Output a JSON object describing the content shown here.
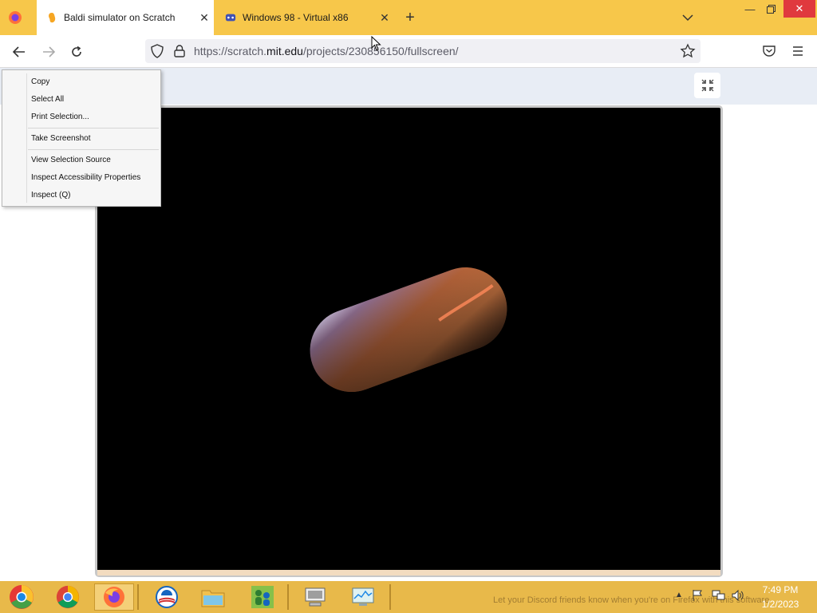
{
  "browser": {
    "tabs": [
      {
        "label": "Baldi simulator on Scratch",
        "active": true
      },
      {
        "label": "Windows 98 - Virtual x86",
        "active": false
      }
    ],
    "url": {
      "prefix": "https://scratch.",
      "domain": "mit.edu",
      "path": "/projects/230856150/fullscreen/"
    },
    "colors": {
      "titlebar": "#f7c74a",
      "active_tab": "#ffffff"
    }
  },
  "context_menu": {
    "items": [
      {
        "label": "Copy"
      },
      {
        "label": "Select All"
      },
      {
        "label": "Print Selection..."
      },
      {
        "label": "Take Screenshot"
      },
      {
        "label": "View Selection Source"
      },
      {
        "label": "Inspect Accessibility Properties"
      },
      {
        "label": "Inspect (Q)"
      }
    ]
  },
  "taskbar": {
    "apps": [
      "chrome-canary-icon",
      "chrome-icon",
      "firefox-icon",
      "obama-logo-icon",
      "file-explorer-icon",
      "messenger-icon",
      "remote-desktop-icon",
      "task-manager-icon"
    ],
    "notification_text": "Let your Discord friends know when you're on Firefox with this software",
    "clock": {
      "time": "7:49 PM",
      "date": "1/2/2023"
    }
  }
}
